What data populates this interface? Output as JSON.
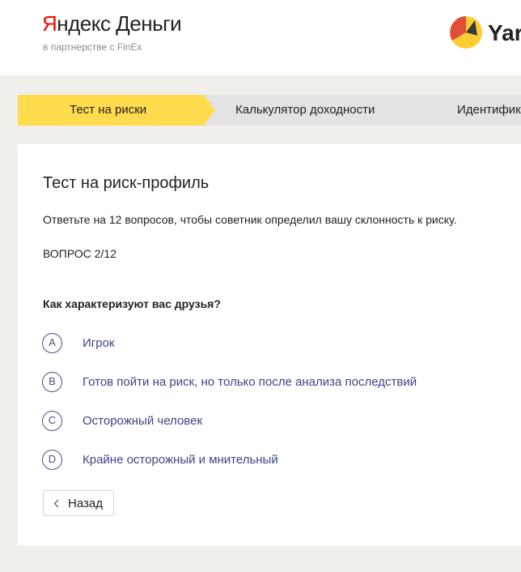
{
  "header": {
    "brand_y": "Я",
    "brand_rest": "ндекс Деньги",
    "brand_sub": "в партнерстве с FinEx",
    "right_logo_text": "Yar",
    "right_logo_icon": "yandex-money-wallet-icon"
  },
  "steps": [
    {
      "label": "Тест на риски",
      "active": true
    },
    {
      "label": "Калькулятор доходности",
      "active": false
    },
    {
      "label": "Идентифик",
      "active": false
    }
  ],
  "colors": {
    "page_bg": "#f0efeb",
    "step_active": "#ffdb4d",
    "step_inactive": "#e3e3e3",
    "option_accent": "#3d4386",
    "brand_red": "#ff0000",
    "logo_yellow": "#ffcc33",
    "logo_red": "#e04e39"
  },
  "card": {
    "title": "Тест на риск-профиль",
    "subtitle": "Ответьте на 12 вопросов, чтобы советник определил вашу склонность к риску.",
    "counter": "ВОПРОС 2/12",
    "question": "Как характеризуют вас друзья?",
    "options": [
      {
        "letter": "A",
        "label": "Игрок"
      },
      {
        "letter": "B",
        "label": "Готов пойти на риск, но только после анализа последствий"
      },
      {
        "letter": "C",
        "label": "Осторожный человек"
      },
      {
        "letter": "D",
        "label": "Крайне осторожный и мнительный"
      }
    ],
    "back_label": "Назад",
    "back_icon": "chevron-left-icon"
  }
}
